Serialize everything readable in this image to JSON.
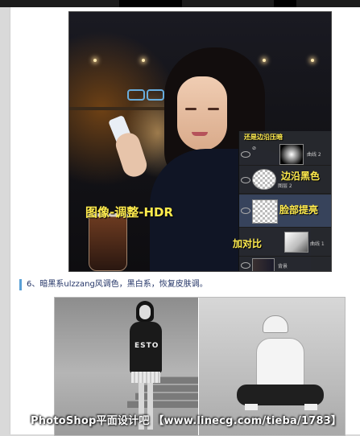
{
  "photo1": {
    "adjust_label": "图像-调整-HDR",
    "layers_panel": {
      "top_note": "还是边沿压暗",
      "layers": [
        {
          "name": "曲线 2",
          "note": ""
        },
        {
          "name": "图层 2",
          "note": "边沿黑色"
        },
        {
          "name": "",
          "note": "脸部提亮"
        },
        {
          "name": "曲线 1",
          "note": "加对比"
        },
        {
          "name": "背景",
          "note": ""
        }
      ]
    }
  },
  "caption": "6、暗黑系ulzzang风调色，黑白系，恢复皮肤调。",
  "photo2": {
    "shirt_text": "ESTO"
  },
  "watermark": "PhotoShop平面设计吧 【www.linecg.com/tieba/1783】"
}
